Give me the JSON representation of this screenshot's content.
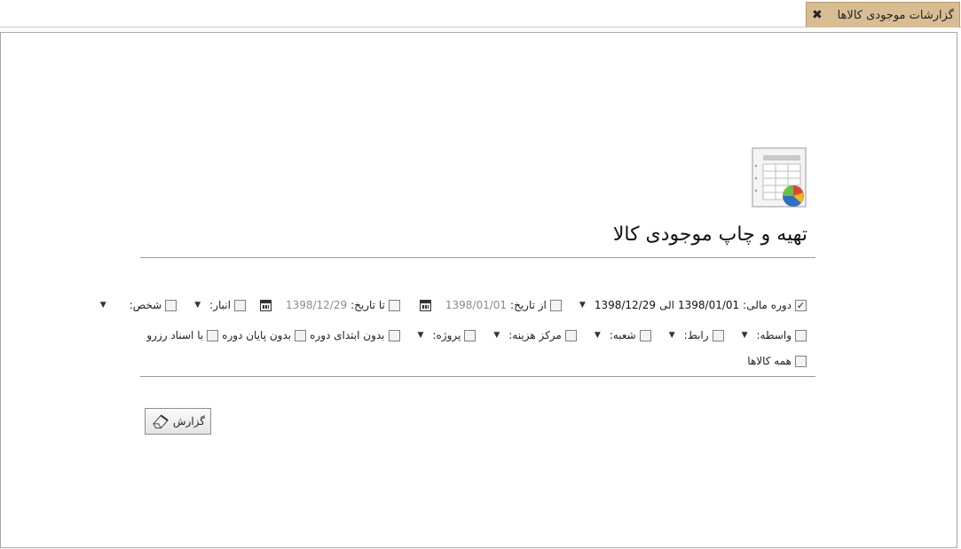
{
  "tab": {
    "title": "گزارشات موجودی کالاها",
    "close_glyph": "✖"
  },
  "page": {
    "title": "تهیه و چاپ موجودی کالا",
    "icon": "spreadsheet-report-icon"
  },
  "filters": {
    "fiscal_period": {
      "label": "دوره مالی:",
      "checked": true,
      "from": "1398/01/01",
      "sep": "الی",
      "to": "1398/12/29"
    },
    "from_date": {
      "label": "از تاریخ:",
      "value": "1398/01/01"
    },
    "to_date": {
      "label": "تا تاریخ:",
      "value": "1398/12/29"
    },
    "warehouse": {
      "label": "انبار:"
    },
    "person": {
      "label": "شخص:"
    },
    "intermediary": {
      "label": "واسطه:"
    },
    "link": {
      "label": "رابط:"
    },
    "branch": {
      "label": "شعبه:"
    },
    "cost_center": {
      "label": "مرکز هزینه:"
    },
    "project": {
      "label": "پروژه:"
    },
    "no_period_start": {
      "label": "بدون ابتدای دوره"
    },
    "no_period_end": {
      "label": "بدون پایان دوره"
    },
    "with_reserve_docs": {
      "label": "با اسناد رزرو"
    },
    "all_goods": {
      "label": "همه کالاها"
    }
  },
  "actions": {
    "report_label": "گزارش"
  },
  "colors": {
    "tab_bg": "#d8bd93",
    "border": "#a8a8a8"
  }
}
